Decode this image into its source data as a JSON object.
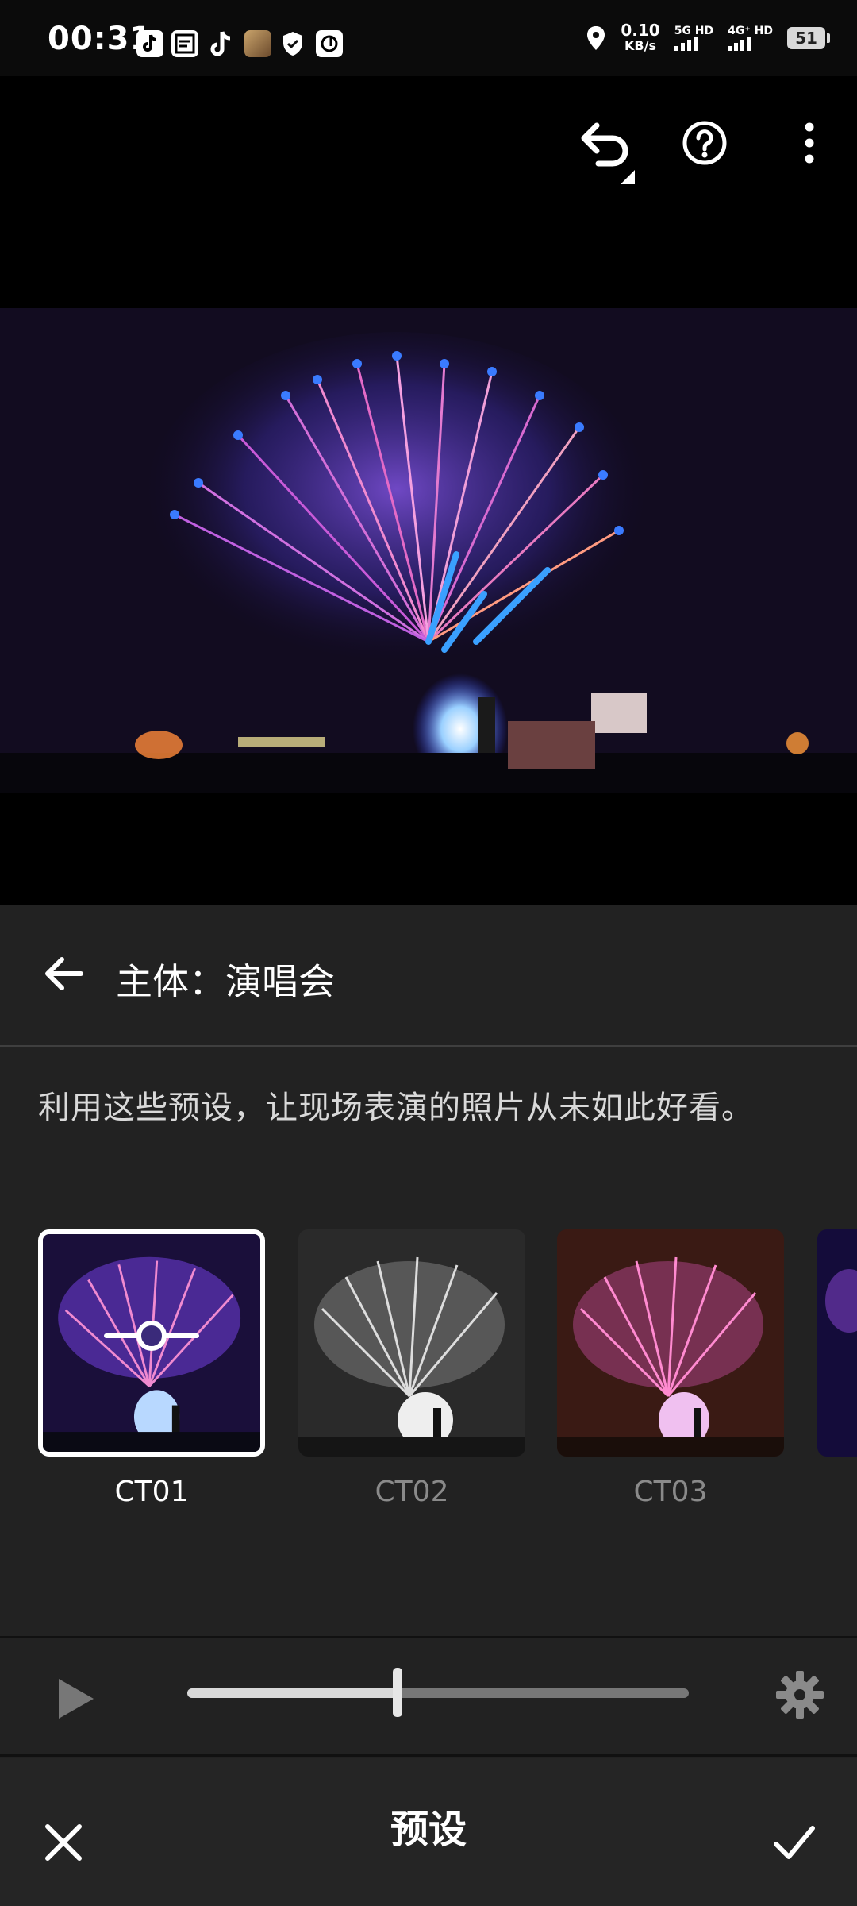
{
  "status_bar": {
    "time": "00:31",
    "net_speed_value": "0.10",
    "net_speed_unit": "KB/s",
    "signal1_label": "5G HD",
    "signal2_label": "4G⁺ HD",
    "battery": "51"
  },
  "panel": {
    "title": "主体：演唱会",
    "description": "利用这些预设，让现场表演的照片从未如此好看。"
  },
  "presets": [
    {
      "label": "CT01",
      "selected": true
    },
    {
      "label": "CT02",
      "selected": false
    },
    {
      "label": "CT03",
      "selected": false
    }
  ],
  "slider": {
    "value": 0.42
  },
  "bottom_bar": {
    "title": "预设"
  },
  "colors": {
    "accent": "#ffffff",
    "panel_bg": "#222222",
    "dim_label": "#8a8a8a"
  }
}
